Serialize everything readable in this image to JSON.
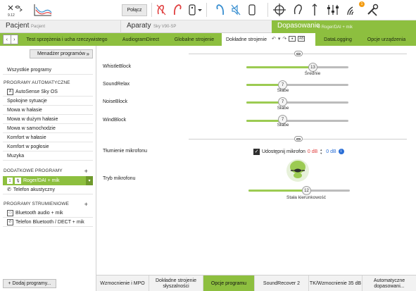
{
  "toolbar": {
    "connect_label": "Połącz",
    "version_label": "9.12",
    "notification_count": "1",
    "accent": "#8dbf3f",
    "icon_red": "#e04040",
    "icon_blue": "#3a8fd0",
    "badge_color": "#f39c12"
  },
  "header": {
    "patient_label": "Pacjent",
    "patient_name": "Pacjent",
    "devices_label": "Aparaty",
    "devices_model": "Sky V90-SP",
    "fitting_label": "Dopasowanie",
    "fitting_program": "Roger/DAI + mik"
  },
  "tabs": [
    {
      "label": "Test sprzężenia i ucha rzeczywistego"
    },
    {
      "label": "AudiogramDirect"
    },
    {
      "label": "Globalne strojenie"
    },
    {
      "label": "Dokładne strojenie"
    },
    {
      "label": "DataLogging"
    },
    {
      "label": "Opcje urządzenia"
    }
  ],
  "tab_tools": {
    "ab_label": "AB"
  },
  "sidebar": {
    "manager_button": "Menadżer programów",
    "all_programs": "Wszystkie programy",
    "auto_heading": "PROGRAMY AUTOMATYCZNE",
    "auto_items": [
      {
        "label": "AutoSense Sky OS"
      },
      {
        "label": "Spokojne sytuacje"
      },
      {
        "label": "Mowa w hałasie"
      },
      {
        "label": "Mowa w dużym hałasie"
      },
      {
        "label": "Mowa w samochodzie"
      },
      {
        "label": "Komfort w hałasie"
      },
      {
        "label": "Komfort w pogłosie"
      },
      {
        "label": "Muzyka"
      }
    ],
    "extra_heading": "DODATKOWE PROGRAMY",
    "extra_items": [
      {
        "label": "Roger/DAI + mik",
        "index": "1"
      },
      {
        "label": "Telefon akustyczny"
      }
    ],
    "stream_heading": "PROGRAMY STRUMIENIOWE",
    "stream_items": [
      {
        "label": "Bluetooth audio + mik"
      },
      {
        "label": "Telefon Bluetooth / DECT + mik"
      }
    ],
    "add_button": "+ Dodaj programy..."
  },
  "main": {
    "params": [
      {
        "label": "WhistleBlock",
        "value": "13",
        "caption": "Średnie",
        "level": 0.68
      },
      {
        "label": "SoundRelax",
        "value": "7",
        "caption": "Słabe",
        "level": 0.36
      },
      {
        "label": "NoiseBlock",
        "value": "7",
        "caption": "Słabe",
        "level": 0.36
      },
      {
        "label": "WindBlock",
        "value": "7",
        "caption": "Słabe",
        "level": 0.36
      }
    ],
    "mute": {
      "label": "Tłumienie mikrofonu",
      "checkbox_label": "Udostępnij mikrofon",
      "value_red": "0 dB",
      "value_blue": "0 dB"
    },
    "mic_mode": {
      "label": "Tryb mikrofonu",
      "value": "12",
      "caption": "Stała kierunkowość",
      "level": 0.58
    }
  },
  "bottom_tabs": [
    {
      "label": "Wzmocnienie i MPO"
    },
    {
      "label": "Dokładne strojenie słyszalności"
    },
    {
      "label": "Opcje programu"
    },
    {
      "label": "SoundRecover 2"
    },
    {
      "label": "TK/Wzmocnienie 35 dB"
    },
    {
      "label": "Automatyczne dopasowani..."
    }
  ]
}
